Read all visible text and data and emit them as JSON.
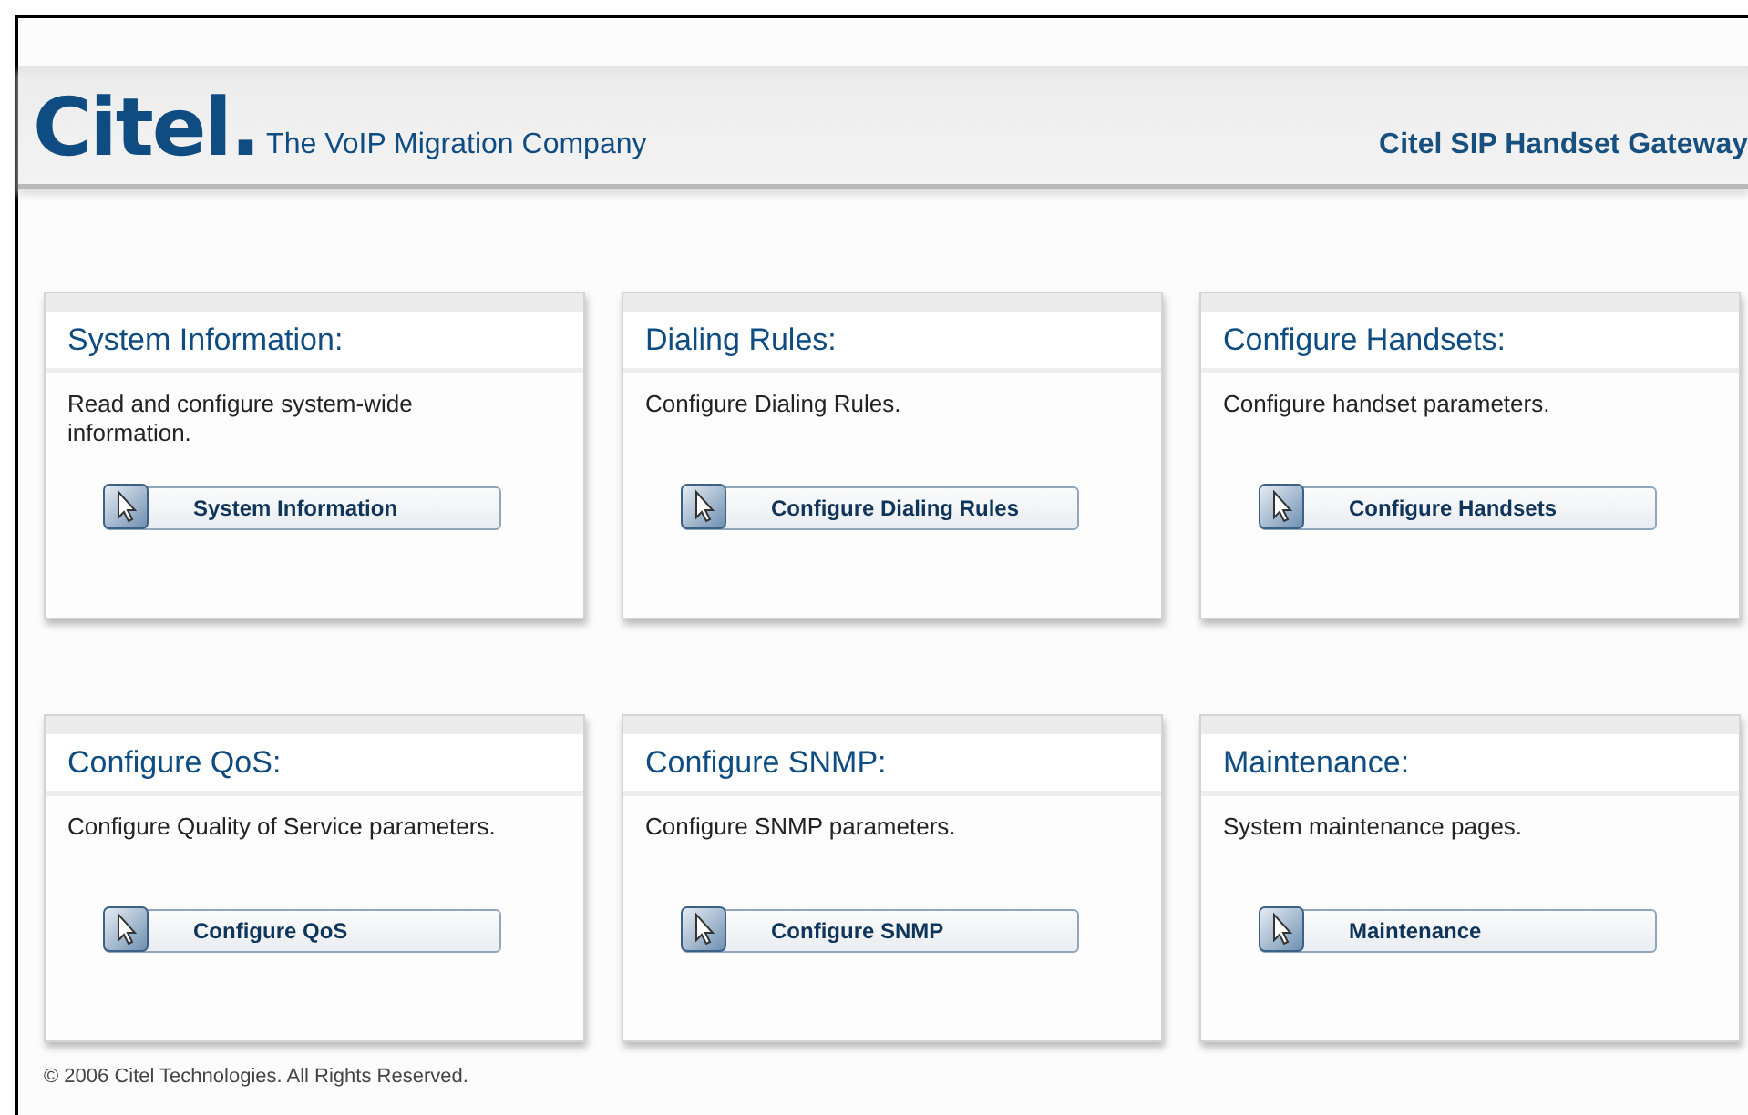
{
  "header": {
    "logo": "Citel.",
    "tagline": "The VoIP Migration Company",
    "product": "Citel SIP Handset Gateway"
  },
  "cards": [
    {
      "title": "System Information:",
      "description": "Read and configure system-wide information.",
      "button": "System Information"
    },
    {
      "title": "Dialing Rules:",
      "description": "Configure Dialing Rules.",
      "button": "Configure Dialing Rules"
    },
    {
      "title": "Configure Handsets:",
      "description": "Configure handset parameters.",
      "button": "Configure Handsets"
    },
    {
      "title": "Configure QoS:",
      "description": "Configure Quality of Service parameters.",
      "button": "Configure QoS"
    },
    {
      "title": "Configure SNMP:",
      "description": "Configure SNMP parameters.",
      "button": "Configure SNMP"
    },
    {
      "title": "Maintenance:",
      "description": "System maintenance pages.",
      "button": "Maintenance"
    }
  ],
  "footer": "© 2006 Citel Technologies. All Rights Reserved."
}
